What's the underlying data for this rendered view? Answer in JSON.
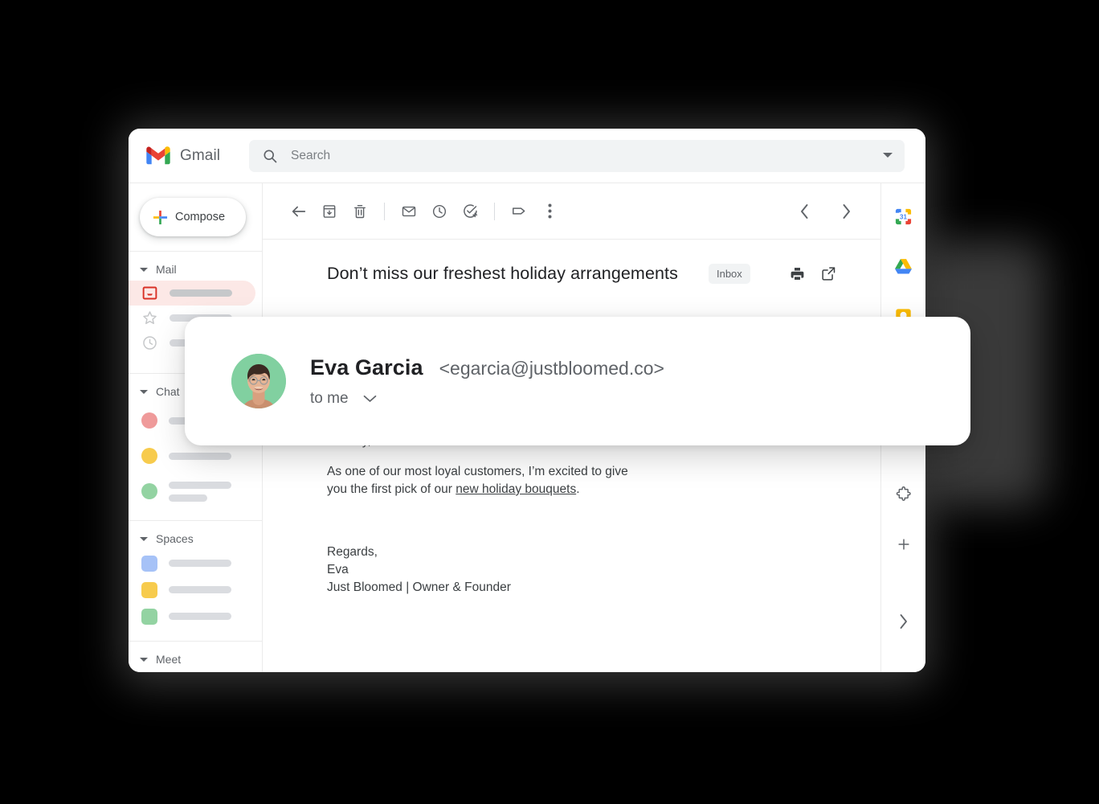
{
  "app": {
    "brand": "Gmail",
    "logo_icon": "gmail-logo-icon"
  },
  "search": {
    "placeholder": "Search",
    "value": "",
    "search_icon": "search-icon",
    "options_icon": "chevron-down-icon"
  },
  "sidebar": {
    "compose": {
      "label": "Compose",
      "icon": "plus-icon"
    },
    "groups": [
      {
        "label": "Mail",
        "caret_icon": "caret-down-icon",
        "items": [
          {
            "name": "inbox",
            "icon": "inbox-icon",
            "active": true
          },
          {
            "name": "starred",
            "icon": "star-icon",
            "active": false
          },
          {
            "name": "snoozed",
            "icon": "clock-icon",
            "active": false
          }
        ]
      },
      {
        "label": "Chat",
        "caret_icon": "caret-down-icon",
        "items": [
          {
            "name": "chat-contact-1",
            "icon": "avatar-dot-red",
            "color": "#ef9a9a"
          },
          {
            "name": "chat-contact-2",
            "icon": "avatar-dot-yellow",
            "color": "#f7cb4d"
          },
          {
            "name": "chat-contact-3",
            "icon": "avatar-dot-green",
            "color": "#93d3a2"
          }
        ]
      },
      {
        "label": "Spaces",
        "caret_icon": "caret-down-icon",
        "items": [
          {
            "name": "space-1",
            "icon": "space-square-blue",
            "color": "#a6c2f7"
          },
          {
            "name": "space-2",
            "icon": "space-square-yellow",
            "color": "#f7cb4d"
          },
          {
            "name": "space-3",
            "icon": "space-square-green",
            "color": "#93d3a2"
          }
        ]
      },
      {
        "label": "Meet",
        "caret_icon": "caret-down-icon",
        "items": [
          {
            "name": "new-meeting",
            "icon": "video-plus-icon"
          },
          {
            "name": "join-meeting",
            "icon": "calendar-icon"
          }
        ]
      }
    ]
  },
  "toolbar": {
    "buttons": [
      {
        "name": "back",
        "icon": "arrow-left-icon"
      },
      {
        "name": "archive",
        "icon": "archive-icon"
      },
      {
        "name": "delete",
        "icon": "trash-icon"
      },
      {
        "name": "mark-unread",
        "icon": "envelope-icon"
      },
      {
        "name": "snooze",
        "icon": "clock-icon"
      },
      {
        "name": "add-to-tasks",
        "icon": "task-add-icon"
      },
      {
        "name": "labels",
        "icon": "label-tag-icon"
      },
      {
        "name": "more",
        "icon": "more-vertical-icon"
      }
    ],
    "nav_prev_icon": "chevron-left-icon",
    "nav_next_icon": "chevron-right-icon"
  },
  "message": {
    "subject": "Don’t miss our freshest holiday arrangements",
    "label_chip": "Inbox",
    "print_icon": "printer-icon",
    "popout_icon": "open-in-new-icon",
    "sender": {
      "name": "Eva Garcia",
      "email": "<egarcia@justbloomed.co>",
      "recipient": "to me",
      "expand_icon": "chevron-down-icon",
      "avatar_name": "sender-avatar",
      "avatar_bg": "#81d0a0"
    },
    "body": {
      "greeting": "Hi Lucy,",
      "paragraph_before_link": "As one of our most loyal customers, I’m excited to give you the first pick of our ",
      "link_text": "new holiday bouquets",
      "paragraph_after_link": ".",
      "sign_off": "Regards,",
      "sign_name": "Eva",
      "sign_title": "Just Bloomed | Owner & Founder"
    }
  },
  "right_rail": {
    "apps": [
      {
        "name": "google-calendar",
        "icon": "calendar-31-icon"
      },
      {
        "name": "google-drive",
        "icon": "drive-icon"
      },
      {
        "name": "google-keep",
        "icon": "keep-icon"
      }
    ],
    "addons": [
      {
        "name": "get-addons",
        "icon": "puzzle-icon"
      },
      {
        "name": "add-addon",
        "icon": "plus-icon"
      }
    ],
    "expand_icon": "chevron-right-icon"
  },
  "colors": {
    "brand_red": "#ea4335",
    "brand_blue": "#4285f4",
    "brand_yellow": "#fbbc04",
    "brand_green": "#34a853",
    "active_row_bg": "#fce8e6",
    "chip_bg": "#f1f3f4",
    "text_primary": "#202124",
    "text_secondary": "#5f6368"
  }
}
